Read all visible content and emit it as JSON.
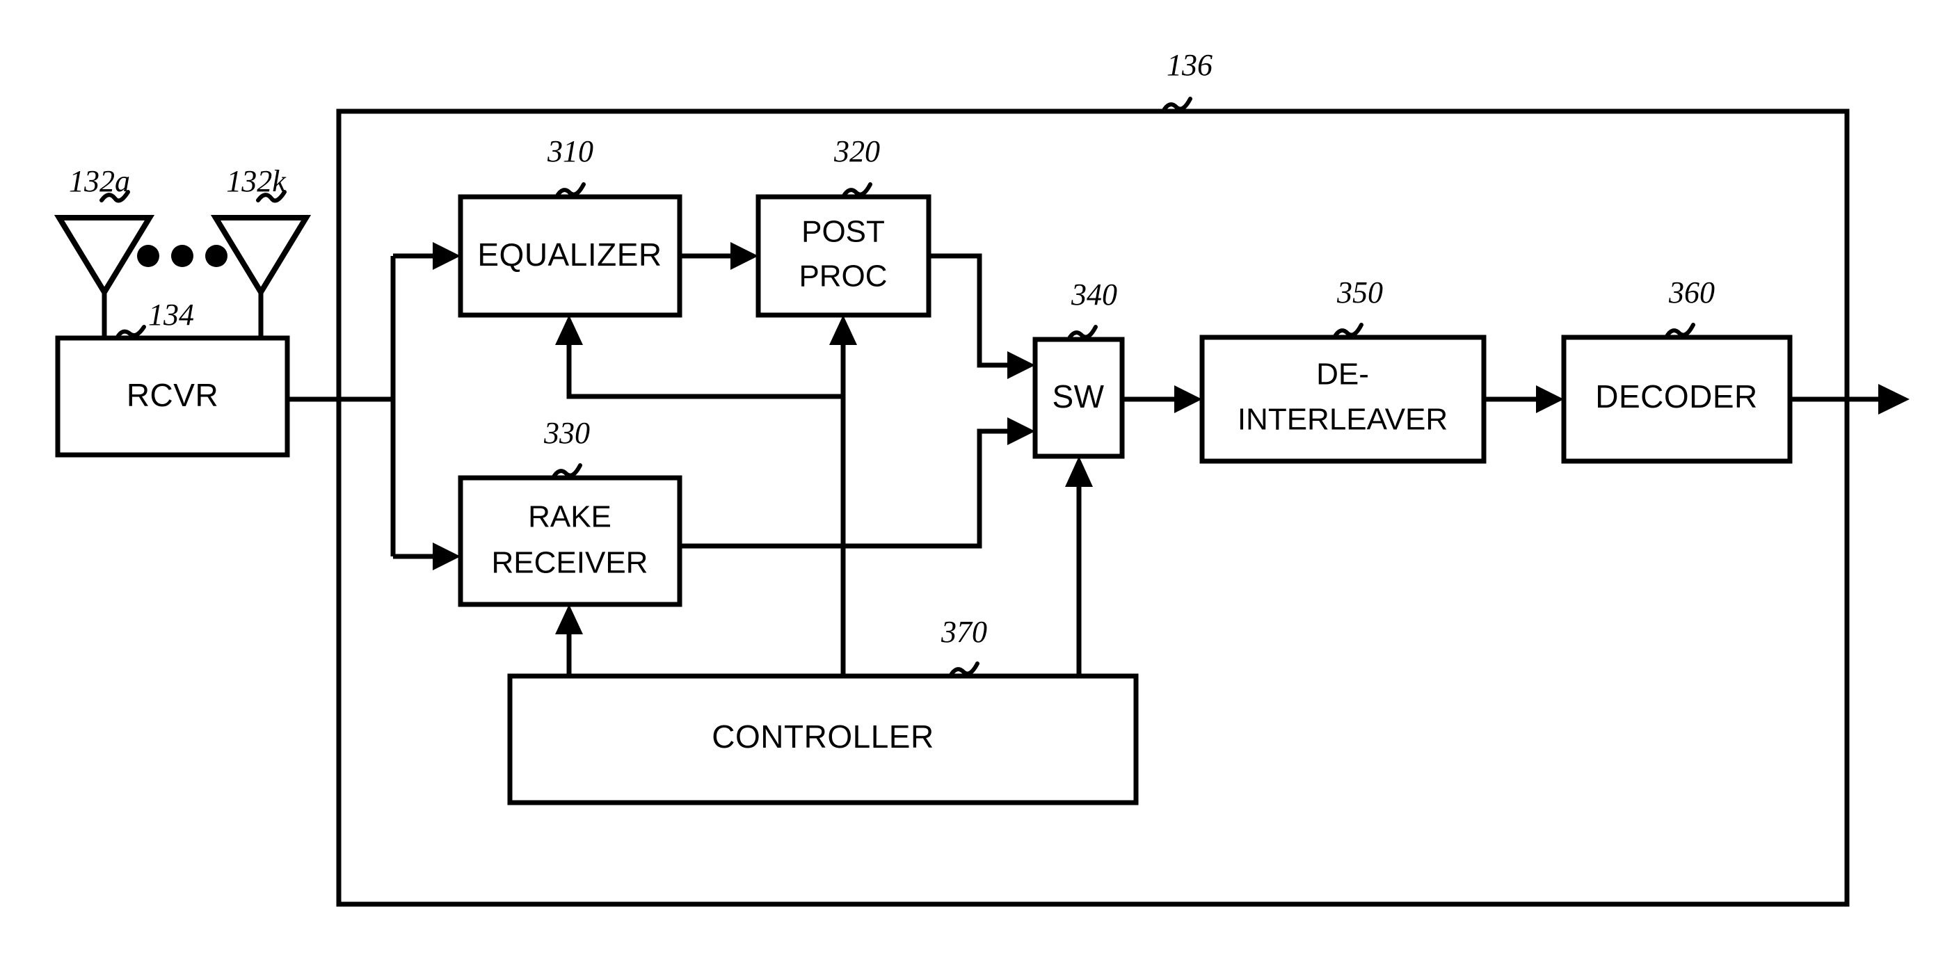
{
  "figure": {
    "type": "patent-block-diagram",
    "title": "Receiver block diagram",
    "outer_block": {
      "ref": "136",
      "label": ""
    },
    "antennas": [
      {
        "ref": "132a",
        "name": "antenna-132a"
      },
      {
        "ref": "132k",
        "name": "antenna-132k"
      }
    ],
    "ellipsis": "•••",
    "blocks": [
      {
        "id": "rcvr",
        "label": "RCVR",
        "ref": "134"
      },
      {
        "id": "equalizer",
        "label": "EQUALIZER",
        "ref": "310"
      },
      {
        "id": "post_proc",
        "label_line1": "POST",
        "label_line2": "PROC",
        "ref": "320"
      },
      {
        "id": "rake_receiver",
        "label_line1": "RAKE",
        "label_line2": "RECEIVER",
        "ref": "330"
      },
      {
        "id": "sw",
        "label": "SW",
        "ref": "340"
      },
      {
        "id": "deinterleaver",
        "label_line1": "DE-",
        "label_line2": "INTERLEAVER",
        "ref": "350"
      },
      {
        "id": "decoder",
        "label": "DECODER",
        "ref": "360"
      },
      {
        "id": "controller",
        "label": "CONTROLLER",
        "ref": "370"
      }
    ],
    "colors": {
      "ink": "#000000",
      "paper": "#ffffff"
    }
  }
}
